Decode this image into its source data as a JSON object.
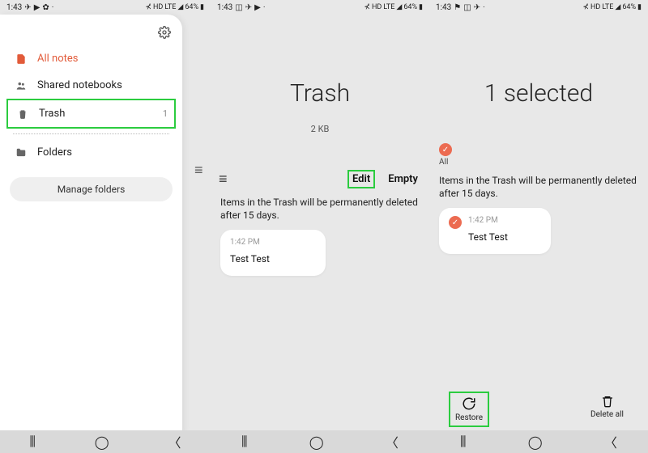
{
  "status": {
    "time": "1:43",
    "battery": "64%",
    "net": "LTE",
    "hd": "HD"
  },
  "drawer": {
    "items": [
      {
        "label": "All notes"
      },
      {
        "label": "Shared notebooks"
      },
      {
        "label": "Trash",
        "count": "1"
      },
      {
        "label": "Folders"
      }
    ],
    "manage": "Manage folders"
  },
  "trash": {
    "title": "Trash",
    "size": "2 KB",
    "edit": "Edit",
    "empty": "Empty",
    "warning": "Items in the Trash will be permanently deleted after 15 days.",
    "note": {
      "time": "1:42 PM",
      "title": "Test Test"
    }
  },
  "select": {
    "title": "1 selected",
    "all": "All",
    "warning": "Items in the Trash will be permanently deleted after 15 days.",
    "note": {
      "time": "1:42 PM",
      "title": "Test Test"
    },
    "restore": "Restore",
    "deleteall": "Delete all"
  }
}
